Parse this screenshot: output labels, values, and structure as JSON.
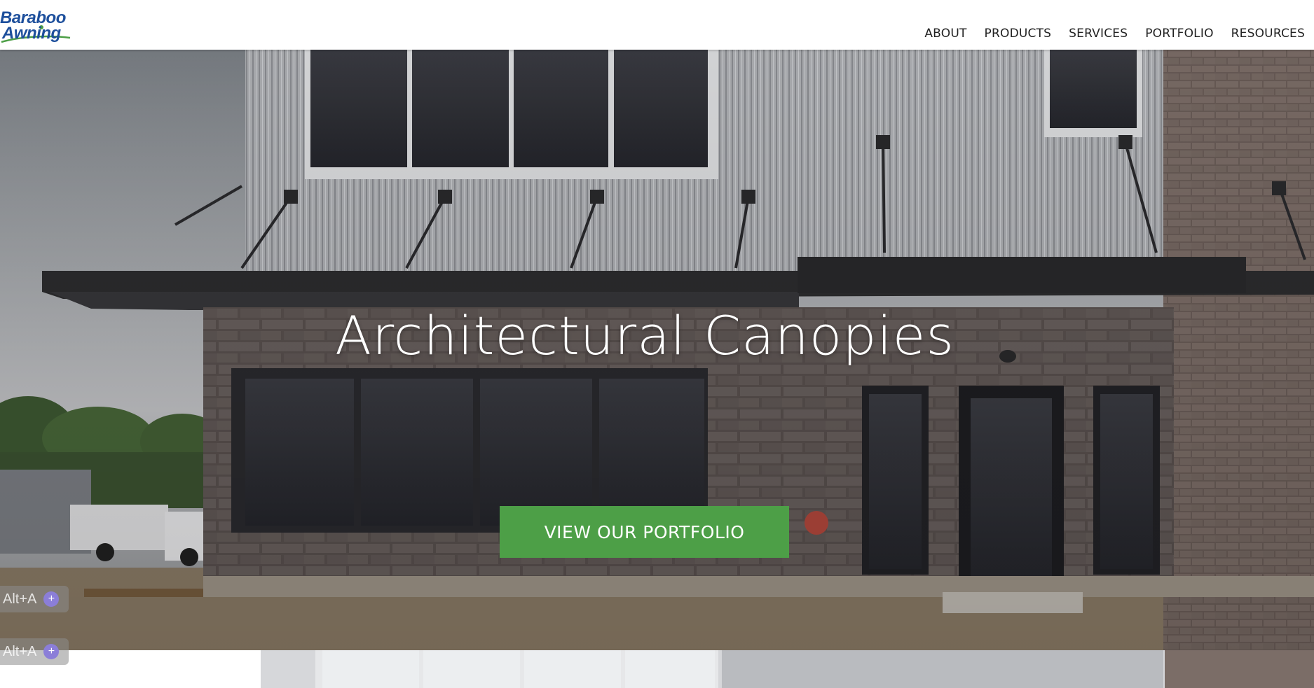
{
  "header": {
    "logo": {
      "line1": "Baraboo",
      "line2": "Awning"
    },
    "nav": [
      {
        "label": "ABOUT"
      },
      {
        "label": "PRODUCTS"
      },
      {
        "label": "SERVICES"
      },
      {
        "label": "PORTFOLIO"
      },
      {
        "label": "RESOURCES"
      }
    ]
  },
  "hero": {
    "title": "Architectural Canopies",
    "cta_label": "VIEW OUR PORTFOLIO",
    "cta_color": "#4d9f47"
  },
  "overlay_badges": [
    {
      "label": "Alt+A"
    },
    {
      "label": "Alt+A"
    }
  ],
  "colors": {
    "brand_blue": "#1d4f9c",
    "brand_green": "#4d9f47"
  }
}
